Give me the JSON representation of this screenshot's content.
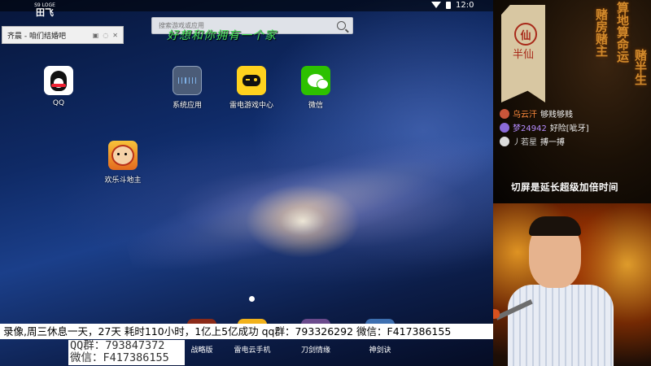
{
  "topbar": {
    "logo_small": "S9 LOGE",
    "logo_main": "田飞",
    "time": "12:0"
  },
  "mini_window": {
    "title": "齐晨 - 咱们结婚吧"
  },
  "search": {
    "placeholder": "搜索游戏或应用"
  },
  "overlay_caption": "好想和你拥有一个家",
  "apps": [
    {
      "label": "QQ"
    },
    {
      "label": "系统应用"
    },
    {
      "label": "雷电游戏中心"
    },
    {
      "label": "微信"
    },
    {
      "label": "欢乐斗地主"
    }
  ],
  "dock": [
    {
      "label": "战略版"
    },
    {
      "label": "雷电云手机"
    },
    {
      "label": "刀剑情缘"
    },
    {
      "label": "神剑诀"
    }
  ],
  "marquee": "录像,周三休息一天，27天 耗时110小时，1亿上5亿成功   qq群：793326292 微信：F417386155",
  "qq_box": {
    "line1": "QQ群：793847372",
    "line2": "微信：F417386155"
  },
  "side": {
    "flag_main": "仙",
    "flag_sub": "半仙",
    "vertical_1": "赌房赌主",
    "vertical_2": "算地算命运",
    "vertical_3": "赌半生",
    "chat": [
      {
        "name": "乌云汗",
        "msg": "够贱够贱",
        "name_color": "#ff8a3c"
      },
      {
        "name": "梦24942",
        "msg": "好险[呲牙]",
        "name_color": "#b58cff"
      },
      {
        "name": "丿若星",
        "msg": "搏一搏",
        "name_color": "#cfcfcf"
      }
    ],
    "notice": "切屏是延长超级加倍时间"
  },
  "colors": {
    "overlay_caption": "#46e05a",
    "accent_orange": "#d28a2c"
  }
}
